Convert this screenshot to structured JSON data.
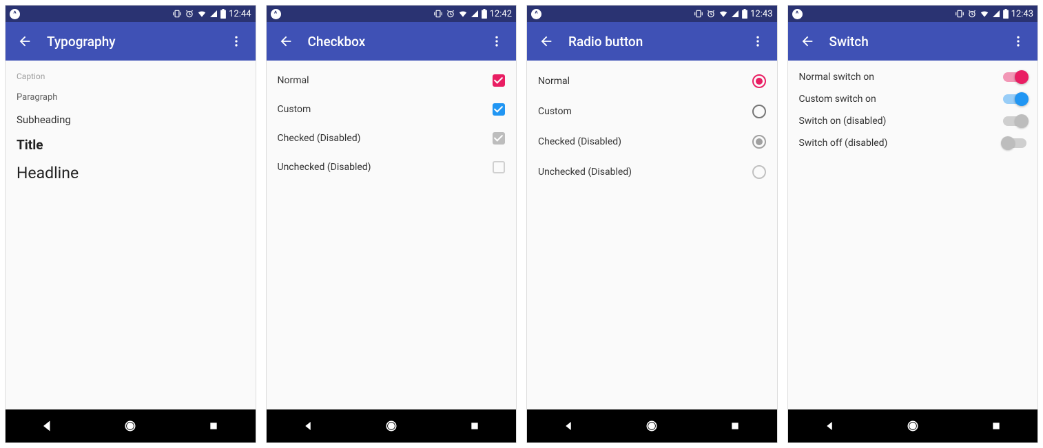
{
  "colors": {
    "primary": "#3f51b5",
    "pink": "#e91e63",
    "blue": "#2196f3"
  },
  "screens": [
    {
      "title": "Typography",
      "time": "12:44",
      "typography": [
        {
          "kind": "caption",
          "text": "Caption"
        },
        {
          "kind": "paragraph",
          "text": "Paragraph"
        },
        {
          "kind": "subheading",
          "text": "Subheading"
        },
        {
          "kind": "title",
          "text": "Title"
        },
        {
          "kind": "headline",
          "text": "Headline"
        }
      ]
    },
    {
      "title": "Checkbox",
      "time": "12:42",
      "items": [
        {
          "label": "Normal",
          "state": "checked",
          "color": "#e91e63",
          "disabled": false
        },
        {
          "label": "Custom",
          "state": "checked",
          "color": "#2196f3",
          "disabled": false
        },
        {
          "label": "Checked (Disabled)",
          "state": "checked",
          "disabled": true
        },
        {
          "label": "Unchecked (Disabled)",
          "state": "unchecked",
          "disabled": true
        }
      ]
    },
    {
      "title": "Radio button",
      "time": "12:43",
      "items": [
        {
          "label": "Normal",
          "state": "checked",
          "color": "#e91e63",
          "disabled": false
        },
        {
          "label": "Custom",
          "state": "unchecked",
          "disabled": false
        },
        {
          "label": "Checked (Disabled)",
          "state": "checked",
          "disabled": true
        },
        {
          "label": "Unchecked (Disabled)",
          "state": "unchecked",
          "disabled": true
        }
      ]
    },
    {
      "title": "Switch",
      "time": "12:43",
      "items": [
        {
          "label": "Normal switch on",
          "state": "on",
          "variant": "pink",
          "disabled": false
        },
        {
          "label": "Custom switch on",
          "state": "on",
          "variant": "blue",
          "disabled": false
        },
        {
          "label": "Switch on (disabled)",
          "state": "on",
          "disabled": true
        },
        {
          "label": "Switch off (disabled)",
          "state": "off",
          "disabled": true
        }
      ]
    }
  ]
}
